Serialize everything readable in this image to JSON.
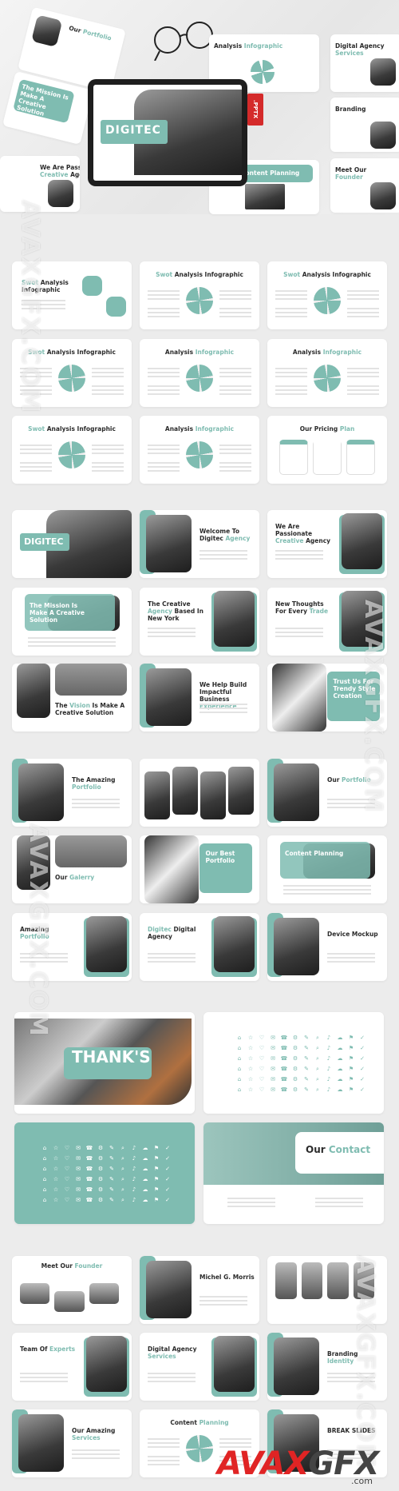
{
  "colors": {
    "accent": "#7fbcb1",
    "background": "#ececec",
    "pptx_tag": "#d42a2a",
    "watermark_red": "#e02424"
  },
  "hero": {
    "brand": "DIGITEC",
    "format_tag": ".PPTX",
    "side_slides": [
      {
        "title": [
          {
            "t": "Our ",
            "a": false
          },
          {
            "t": "Portfolio",
            "a": true
          }
        ]
      },
      {
        "title": [
          {
            "t": "The Mission Is Make A Creative Solution",
            "a": false
          }
        ]
      },
      {
        "title": [
          {
            "t": "We Are Passionate ",
            "a": false
          },
          {
            "t": "Creative ",
            "a": true
          },
          {
            "t": "Agency",
            "a": false
          }
        ]
      },
      {
        "title": [
          {
            "t": "Analysis ",
            "a": false
          },
          {
            "t": "Infographic",
            "a": true
          }
        ]
      },
      {
        "title": [
          {
            "t": "Digital Agency ",
            "a": false
          },
          {
            "t": "Services",
            "a": true
          }
        ]
      },
      {
        "title": [
          {
            "t": "Branding",
            "a": false
          }
        ]
      },
      {
        "title": [
          {
            "t": "Content Planning",
            "a": false
          }
        ]
      },
      {
        "title": [
          {
            "t": "Meet Our ",
            "a": false
          },
          {
            "t": "Founder",
            "a": true
          }
        ]
      }
    ]
  },
  "sections": [
    {
      "slides": [
        {
          "layout": "infographic-left",
          "title": [
            {
              "t": "Swot ",
              "a": true
            },
            {
              "t": "Analysis Infographic",
              "a": false
            }
          ]
        },
        {
          "layout": "infographic",
          "title": [
            {
              "t": "Swot ",
              "a": true
            },
            {
              "t": "Analysis Infographic",
              "a": false
            }
          ]
        },
        {
          "layout": "infographic",
          "title": [
            {
              "t": "Swot ",
              "a": true
            },
            {
              "t": "Analysis Infographic",
              "a": false
            }
          ]
        },
        {
          "layout": "infographic",
          "title": [
            {
              "t": "Swot ",
              "a": true
            },
            {
              "t": "Analysis Infographic",
              "a": false
            }
          ]
        },
        {
          "layout": "infographic",
          "title": [
            {
              "t": "Analysis ",
              "a": false
            },
            {
              "t": "Infographic",
              "a": true
            }
          ]
        },
        {
          "layout": "infographic",
          "title": [
            {
              "t": "Analysis ",
              "a": false
            },
            {
              "t": "Infographic",
              "a": true
            }
          ]
        },
        {
          "layout": "infographic",
          "title": [
            {
              "t": "Swot ",
              "a": true
            },
            {
              "t": "Analysis Infographic",
              "a": false
            }
          ]
        },
        {
          "layout": "infographic",
          "title": [
            {
              "t": "Analysis ",
              "a": false
            },
            {
              "t": "Infographic",
              "a": true
            }
          ]
        },
        {
          "layout": "pricing",
          "title": [
            {
              "t": "Our Pricing ",
              "a": false
            },
            {
              "t": "Plan",
              "a": true
            }
          ]
        }
      ]
    },
    {
      "slides": [
        {
          "layout": "cover",
          "title": [
            {
              "t": "DIGITEC",
              "a": false
            }
          ]
        },
        {
          "layout": "image-left",
          "title": [
            {
              "t": "Welcome To Digitec ",
              "a": false
            },
            {
              "t": "Agency",
              "a": true
            }
          ]
        },
        {
          "layout": "image-right",
          "title": [
            {
              "t": "We Are Passionate ",
              "a": false
            },
            {
              "t": "Creative ",
              "a": true
            },
            {
              "t": "Agency",
              "a": false
            }
          ]
        },
        {
          "layout": "teal-banner",
          "title": [
            {
              "t": "The Mission Is Make A Creative Solution",
              "a": false
            }
          ]
        },
        {
          "layout": "image-right",
          "title": [
            {
              "t": "The Creative ",
              "a": false
            },
            {
              "t": "Agency ",
              "a": true
            },
            {
              "t": "Based In New York",
              "a": false
            }
          ]
        },
        {
          "layout": "image-right",
          "title": [
            {
              "t": "New Thoughts For Every ",
              "a": false
            },
            {
              "t": "Trade",
              "a": true
            }
          ]
        },
        {
          "layout": "image-top",
          "title": [
            {
              "t": "The ",
              "a": false
            },
            {
              "t": "Vision ",
              "a": true
            },
            {
              "t": "Is Make A Creative Solution",
              "a": false
            }
          ]
        },
        {
          "layout": "image-left",
          "title": [
            {
              "t": "We Help Build Impactful Business ",
              "a": false
            },
            {
              "t": "Experience",
              "a": true
            }
          ]
        },
        {
          "layout": "teal-right",
          "title": [
            {
              "t": "Trust Us For Trendy Style Creation",
              "a": false
            }
          ]
        }
      ]
    },
    {
      "slides": [
        {
          "layout": "image-left",
          "title": [
            {
              "t": "The Amazing ",
              "a": false
            },
            {
              "t": "Portfolio",
              "a": true
            }
          ]
        },
        {
          "layout": "gallery",
          "title": []
        },
        {
          "layout": "image-left",
          "title": [
            {
              "t": "Our ",
              "a": false
            },
            {
              "t": "Portfolio",
              "a": true
            }
          ]
        },
        {
          "layout": "image-top",
          "title": [
            {
              "t": "Our ",
              "a": false
            },
            {
              "t": "Galerry",
              "a": true
            }
          ]
        },
        {
          "layout": "teal-right",
          "title": [
            {
              "t": "Our Best Portfolio",
              "a": false
            }
          ]
        },
        {
          "layout": "teal-banner",
          "title": [
            {
              "t": "Content Planning",
              "a": false
            }
          ]
        },
        {
          "layout": "image-right",
          "title": [
            {
              "t": "Amazing ",
              "a": false
            },
            {
              "t": "Portfolio",
              "a": true
            }
          ]
        },
        {
          "layout": "image-right",
          "title": [
            {
              "t": "Digitec ",
              "a": true
            },
            {
              "t": "Digital Agency",
              "a": false
            }
          ]
        },
        {
          "layout": "image-left",
          "title": [
            {
              "t": "Device Mockup",
              "a": false
            }
          ]
        }
      ]
    },
    {
      "slides": [
        {
          "layout": "thanks",
          "title": [
            {
              "t": "THANK'S",
              "a": false
            }
          ]
        },
        {
          "layout": "icons",
          "title": []
        },
        {
          "layout": "icons-teal",
          "title": []
        },
        {
          "layout": "contact",
          "title": [
            {
              "t": "Our ",
              "a": false
            },
            {
              "t": "Contact",
              "a": true
            }
          ]
        }
      ]
    },
    {
      "slides": [
        {
          "layout": "people",
          "title": [
            {
              "t": "Meet Our ",
              "a": false
            },
            {
              "t": "Founder",
              "a": true
            }
          ]
        },
        {
          "layout": "image-left",
          "title": [
            {
              "t": "Michel G. Morris",
              "a": false
            }
          ]
        },
        {
          "layout": "people",
          "title": []
        },
        {
          "layout": "image-right",
          "title": [
            {
              "t": "Team Of ",
              "a": false
            },
            {
              "t": "Experts",
              "a": true
            }
          ]
        },
        {
          "layout": "image-right",
          "title": [
            {
              "t": "Digital Agency ",
              "a": false
            },
            {
              "t": "Services",
              "a": true
            }
          ]
        },
        {
          "layout": "image-left",
          "title": [
            {
              "t": "Branding ",
              "a": false
            },
            {
              "t": "Identity",
              "a": true
            }
          ]
        },
        {
          "layout": "image-left",
          "title": [
            {
              "t": "Our Amazing ",
              "a": false
            },
            {
              "t": "Services",
              "a": true
            }
          ]
        },
        {
          "layout": "infographic",
          "title": [
            {
              "t": "Content ",
              "a": false
            },
            {
              "t": "Planning",
              "a": true
            }
          ]
        },
        {
          "layout": "image-left",
          "title": [
            {
              "t": "BREAK SLIDES",
              "a": false
            }
          ]
        }
      ]
    }
  ],
  "watermark": {
    "text": "AVAXGFX.COM",
    "logo_main": "AVAXGFX",
    "logo_suffix": ".com"
  }
}
